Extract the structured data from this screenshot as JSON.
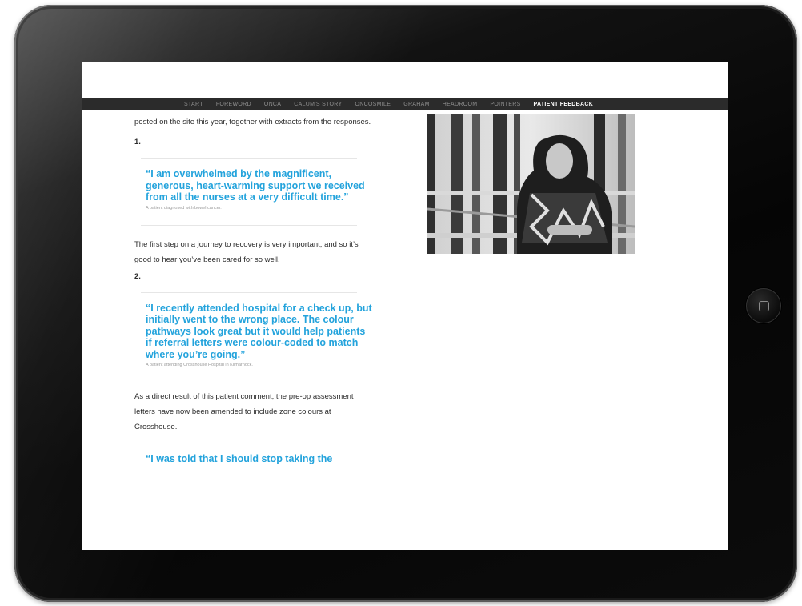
{
  "nav": {
    "items": [
      "START",
      "FOREWORD",
      "ONCA",
      "CALUM'S STORY",
      "ONCOSMILE",
      "GRAHAM",
      "HEADROOM",
      "POINTERS",
      "PATIENT FEEDBACK"
    ],
    "active_index": 8
  },
  "article": {
    "intro": "posted on the site this year, together with extracts from the responses.",
    "item1_number": "1.",
    "quote1": "“I am overwhelmed by the magnificent, generous, heart-warming support we received from all the nurses at a very difficult time.”",
    "attrib1": "A patient diagnosed with bowel cancer.",
    "response1": "The first step on a journey to recovery is very important, and so it’s good to hear you’ve been cared for so well.",
    "item2_number": "2.",
    "quote2": "“I recently attended hospital for a check up, but initially went to the wrong place. The colour pathways look great but it would help patients if referral letters were colour-coded to match where you’re going.”",
    "attrib2": "A patient attending Crosshouse Hospital in Kilmarnock.",
    "response2": "As a direct result of this patient comment, the pre-op assessment letters have now been amended to include zone colours at Crosshouse.",
    "quote3": "“I was told that I should stop taking the"
  },
  "colors": {
    "accent": "#23a3dc",
    "navbar": "#2b2b2b",
    "bezel": "#0a0a0a"
  }
}
